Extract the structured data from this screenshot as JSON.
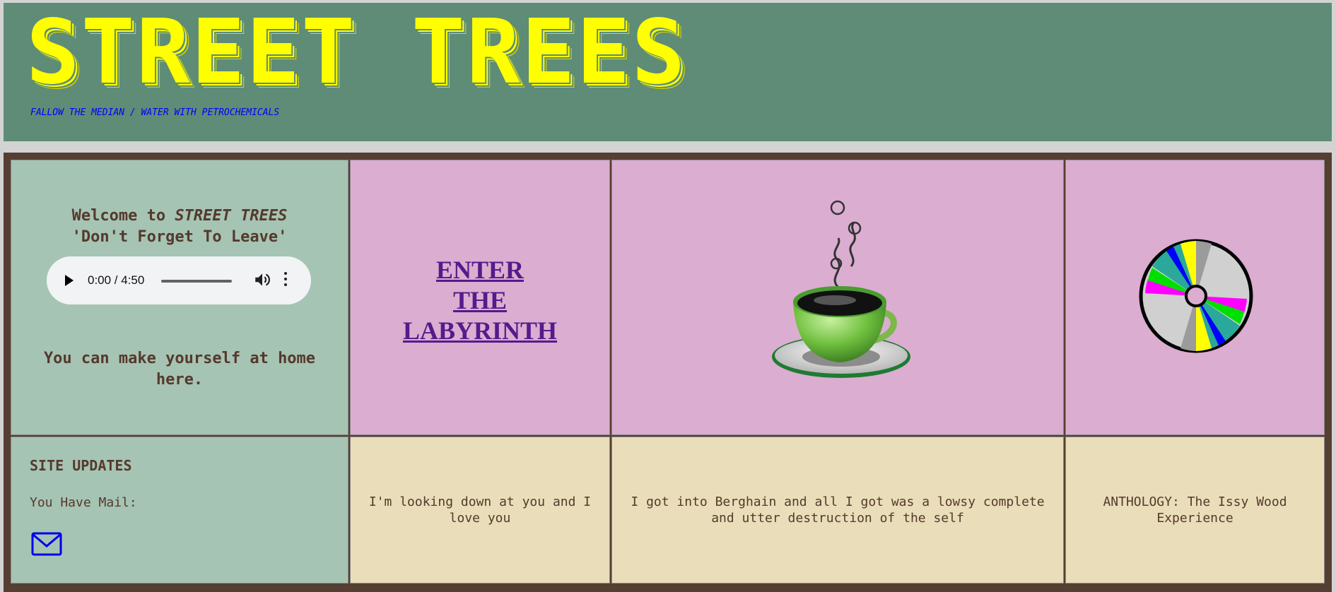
{
  "header": {
    "title": "STREET TREES",
    "tagline": "FALLOW THE MEDIAN / WATER WITH PETROCHEMICALS"
  },
  "welcome": {
    "prefix": "Welcome to ",
    "site_name": "STREET TREES",
    "quote": "'Don't Forget To Leave'",
    "home_text": "You can make yourself at home here."
  },
  "audio_player": {
    "time": "0:00 / 4:50"
  },
  "nav": {
    "labyrinth_line1": "ENTER",
    "labyrinth_line2": "THE",
    "labyrinth_line3": "LABYRINTH"
  },
  "updates": {
    "title": "SITE UPDATES",
    "mail_label": "You Have Mail:"
  },
  "captions": {
    "coffee": "I'm looking down at you and I love you",
    "berghain": "I got into Berghain and all I got was a lowsy complete and utter destruction of the self",
    "cd": "ANTHOLOGY: The Issy Wood Experience"
  },
  "icons": {
    "coffee": "coffee-cup-icon",
    "cd": "cd-disc-icon",
    "mail": "mail-envelope-icon"
  },
  "colors": {
    "banner": "#5e8c76",
    "title": "#ffff00",
    "tagline": "#0000ff",
    "frame": "#553e32",
    "green_cell": "#a6c4b3",
    "pink_cell": "#dbadd0",
    "cream_cell": "#e9deb9",
    "text": "#55392d",
    "link": "#551a8b"
  }
}
